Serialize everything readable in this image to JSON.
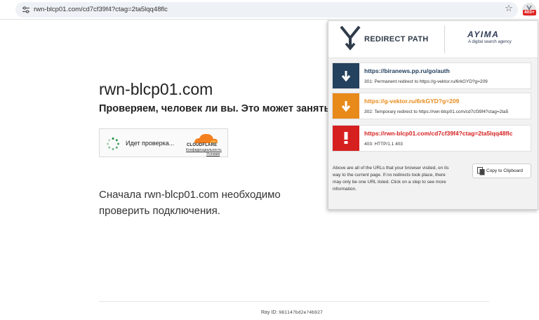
{
  "browser": {
    "url": "rwn-blcp01.com/cd7cf39f4?ctag=2ta5lqq48flc",
    "extension_badge": "403+"
  },
  "page": {
    "site_title": "rwn-blcp01.com",
    "subtitle": "Проверяем, человек ли вы. Это может занять н",
    "widget": {
      "status_text": "Идет проверка...",
      "brand": "CLOUDFLARE",
      "privacy_link": "Конфиденциальность",
      "terms_link": "Условия"
    },
    "body_text": "Сначала rwn-blcp01.com необходимо проверить подключения.",
    "ray_label": "Ray ID:",
    "ray_value": "98114?bd2e?4b927"
  },
  "popup": {
    "brand_name": "REDIRECT PATH",
    "partner_name": "AYIMA",
    "partner_tagline": "A digital search agency",
    "redirects": [
      {
        "status": "301",
        "url": "https://biranews.pp.ru/go/auth",
        "description": "301: Permanent redirect to https://g-vektor.ru/6rkGYD?g=209",
        "color": "#24415e"
      },
      {
        "status": "302",
        "url": "https://g-vektor.ru/6rkGYD?g=209",
        "description": "302: Temporary redirect to https://rwn-blcp01.com/cd7cf39f4?ctag=2ta5",
        "color": "#e88a1a"
      },
      {
        "status": "403",
        "url": "https://rwn-blcp01.com/cd7cf39f4?ctag=2ta5lqq48flc",
        "description": "403: HTTP/1.1 403",
        "color": "#d62020"
      }
    ],
    "note": "Above are all of the URLs that your browser visited, on its way to the current page. If no redirects took place, there may only be one URL listed. Click on a step to see more information.",
    "copy_button": "Copy to Clipboard"
  }
}
